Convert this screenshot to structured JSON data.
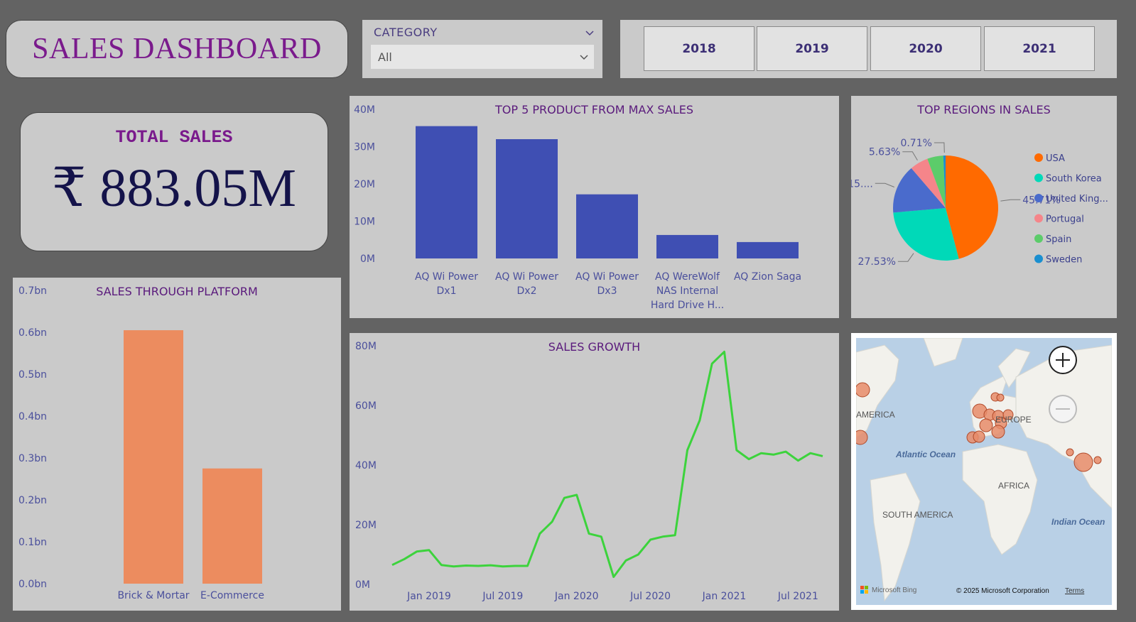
{
  "header": {
    "title": "SALES DASHBOARD"
  },
  "total": {
    "label": "TOTAL SALES",
    "value": "₹ 883.05M"
  },
  "category_slicer": {
    "label": "CATEGORY",
    "selected": "All"
  },
  "year_buttons": [
    "2018",
    "2019",
    "2020",
    "2021"
  ],
  "colors": {
    "panel": "#cacaca",
    "background": "#636363",
    "bar_blue": "#3f4fb3",
    "bar_orange": "#ec8c5f",
    "line_green": "#3cd33c",
    "title_purple": "#7a1a8c"
  },
  "chart_data": [
    {
      "id": "top5",
      "type": "bar",
      "title": "TOP 5 PRODUCT FROM MAX SALES",
      "categories": [
        [
          "AQ Wi Power",
          "Dx1"
        ],
        [
          "AQ Wi Power",
          "Dx2"
        ],
        [
          "AQ Wi Power",
          "Dx3"
        ],
        [
          "AQ WereWolf",
          "NAS Internal",
          "Hard Drive H..."
        ],
        [
          "AQ Zion Saga"
        ]
      ],
      "values": [
        35.5,
        32,
        17.2,
        6.3,
        4.4
      ],
      "unit": "M",
      "ylim": [
        0,
        40
      ],
      "yticks": [
        "0M",
        "10M",
        "20M",
        "30M",
        "40M"
      ],
      "grid": false
    },
    {
      "id": "regions",
      "type": "pie",
      "title": "TOP REGIONS IN SALES",
      "labels": [
        "USA",
        "South Korea",
        "United King...",
        "Portugal",
        "Spain",
        "Sweden"
      ],
      "values": [
        45.71,
        27.53,
        15.0,
        5.63,
        4.9,
        0.71
      ],
      "slice_labels": [
        "45.71%",
        "27.53%",
        "15....",
        "5.63%",
        "",
        "0.71%"
      ],
      "colors": [
        "#ff6a00",
        "#00d9b8",
        "#4a6bcc",
        "#f5858a",
        "#5ccc6a",
        "#1a8fd0"
      ],
      "legend": "right"
    },
    {
      "id": "platform",
      "type": "bar",
      "title": "SALES THROUGH PLATFORM",
      "categories": [
        "Brick & Mortar",
        "E-Commerce"
      ],
      "values": [
        0.605,
        0.275
      ],
      "unit": "bn",
      "ylim": [
        0,
        0.7
      ],
      "yticks": [
        "0.0bn",
        "0.1bn",
        "0.2bn",
        "0.3bn",
        "0.4bn",
        "0.5bn",
        "0.6bn",
        "0.7bn"
      ],
      "grid": false
    },
    {
      "id": "growth",
      "type": "line",
      "title": "SALES GROWTH",
      "x": [
        "2018-10",
        "2018-11",
        "2018-12",
        "2019-01",
        "2019-02",
        "2019-03",
        "2019-04",
        "2019-05",
        "2019-06",
        "2019-07",
        "2019-08",
        "2019-09",
        "2019-10",
        "2019-11",
        "2019-12",
        "2020-01",
        "2020-02",
        "2020-03",
        "2020-04",
        "2020-05",
        "2020-06",
        "2020-07",
        "2020-08",
        "2020-09",
        "2020-10",
        "2020-11",
        "2020-12",
        "2021-01",
        "2021-02",
        "2021-03",
        "2021-04",
        "2021-05",
        "2021-06",
        "2021-07",
        "2021-08",
        "2021-09"
      ],
      "values": [
        6.5,
        8.5,
        11,
        11.5,
        6.5,
        6,
        6.3,
        6.2,
        6.4,
        6,
        6.2,
        6.2,
        17,
        21,
        29,
        30,
        17,
        16,
        2.5,
        8,
        10,
        15,
        16,
        16.5,
        45,
        55,
        74,
        78,
        45,
        42,
        44,
        43.5,
        44.5,
        41.5,
        44,
        43
      ],
      "unit": "M",
      "ylim": [
        0,
        80
      ],
      "yticks": [
        "0M",
        "20M",
        "40M",
        "60M",
        "80M"
      ],
      "xticks": [
        "Jan 2019",
        "Jul 2019",
        "Jan 2020",
        "Jul 2020",
        "Jan 2021",
        "Jul 2021"
      ],
      "grid": false
    }
  ],
  "map": {
    "labels": {
      "america": "AMERICA",
      "europe": "EUROPE",
      "atlantic": "Atlantic Ocean",
      "africa": "AFRICA",
      "south_america": "SOUTH AMERICA",
      "indian": "Indian Ocean"
    },
    "credit": "Microsoft Bing",
    "copyright": "© 2025 Microsoft Corporation",
    "terms": "Terms"
  }
}
